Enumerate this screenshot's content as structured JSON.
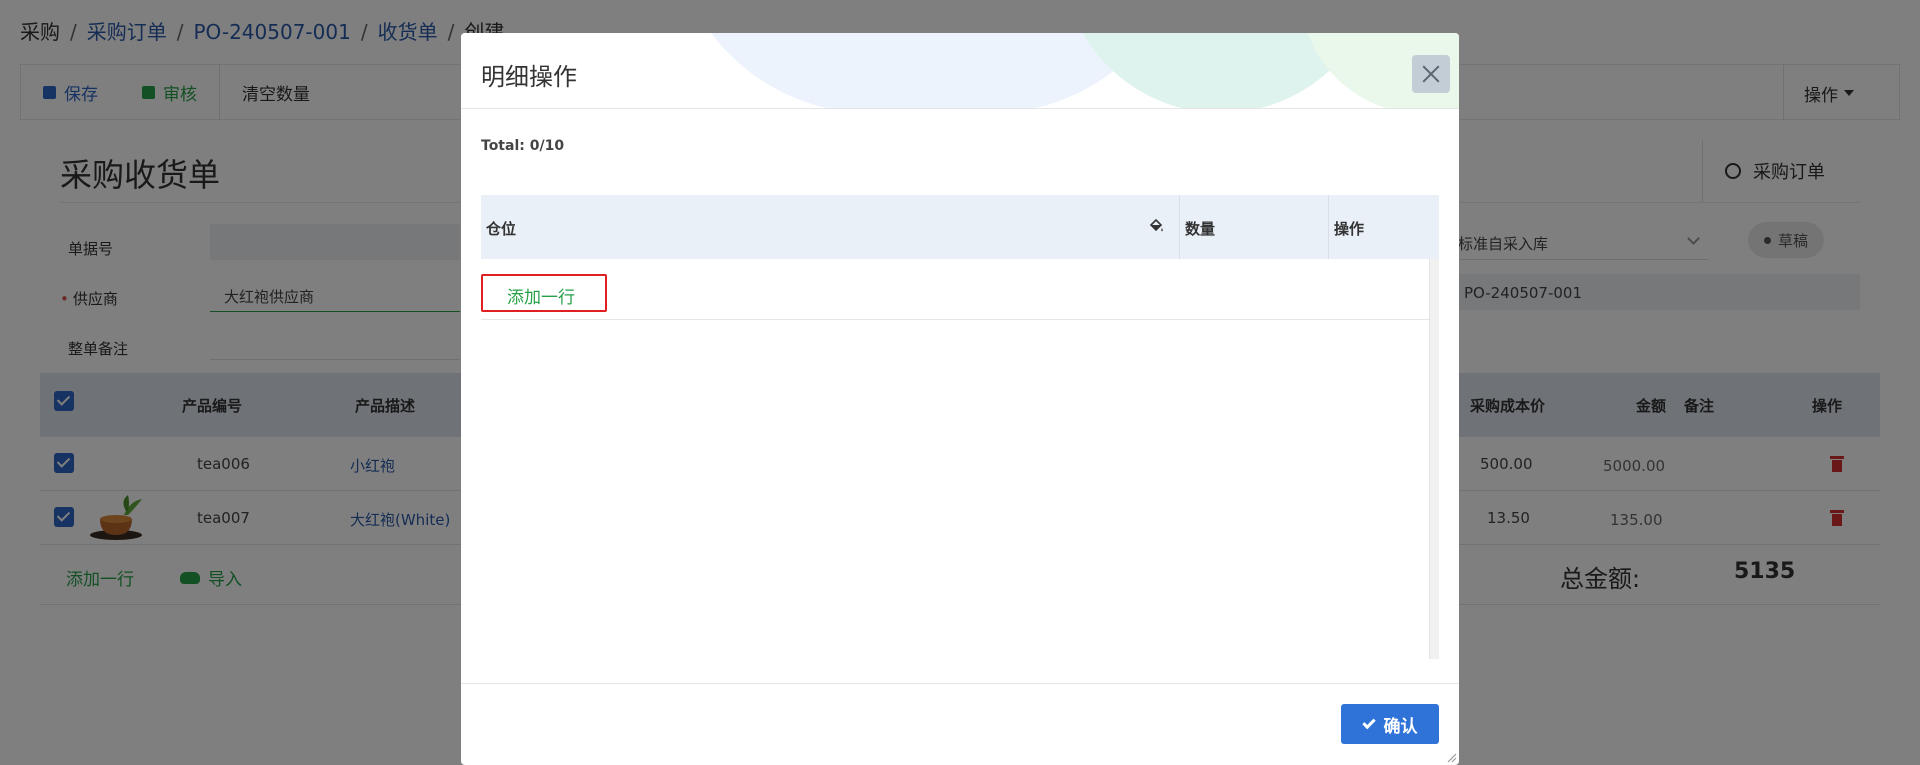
{
  "breadcrumb": {
    "root": "采购",
    "sep": "/",
    "level1": "采购订单",
    "level2": "PO-240507-001",
    "level3": "收货单",
    "current": "创建"
  },
  "toolbar": {
    "save_label": "保存",
    "approve_label": "审核",
    "clear_label": "清空数量",
    "actions_label": "操作"
  },
  "form": {
    "title": "采购收货单",
    "po_link_label": "采购订单",
    "doc_no_label": "单据号",
    "doc_no_value": "",
    "supplier_label": "供应商",
    "supplier_value": "大红袍供应商",
    "remark_label": "整单备注",
    "remark_value": "",
    "warehouse_value": "标准自采入库",
    "po_ref_value": "PO-240507-001",
    "status": "草稿"
  },
  "grid": {
    "headers": {
      "product_code": "产品编号",
      "product_desc": "产品描述",
      "unit_cost": "采购成本价",
      "amount": "金额",
      "remark": "备注",
      "action": "操作"
    },
    "rows": [
      {
        "code": "tea006",
        "desc": "小红袍",
        "unit_cost": "500.00",
        "amount": "5000.00"
      },
      {
        "code": "tea007",
        "desc": "大红袍(White)",
        "unit_cost": "13.50",
        "amount": "135.00"
      }
    ],
    "add_row_label": "添加一行",
    "import_label": "导入",
    "total_label": "总金额:",
    "total_value": "5135"
  },
  "modal": {
    "title": "明细操作",
    "total_count": "Total: 0/10",
    "columns": {
      "location": "仓位",
      "quantity": "数量",
      "action": "操作"
    },
    "add_row_label": "添加一行",
    "confirm_label": "确认"
  },
  "colors": {
    "primary": "#2f73d9",
    "success": "#27a048",
    "danger": "#d32f2f",
    "highlight_border": "#e02020"
  },
  "icons": {
    "close": "close-icon",
    "bucket": "paint-bucket-icon",
    "confirm": "check-icon"
  }
}
